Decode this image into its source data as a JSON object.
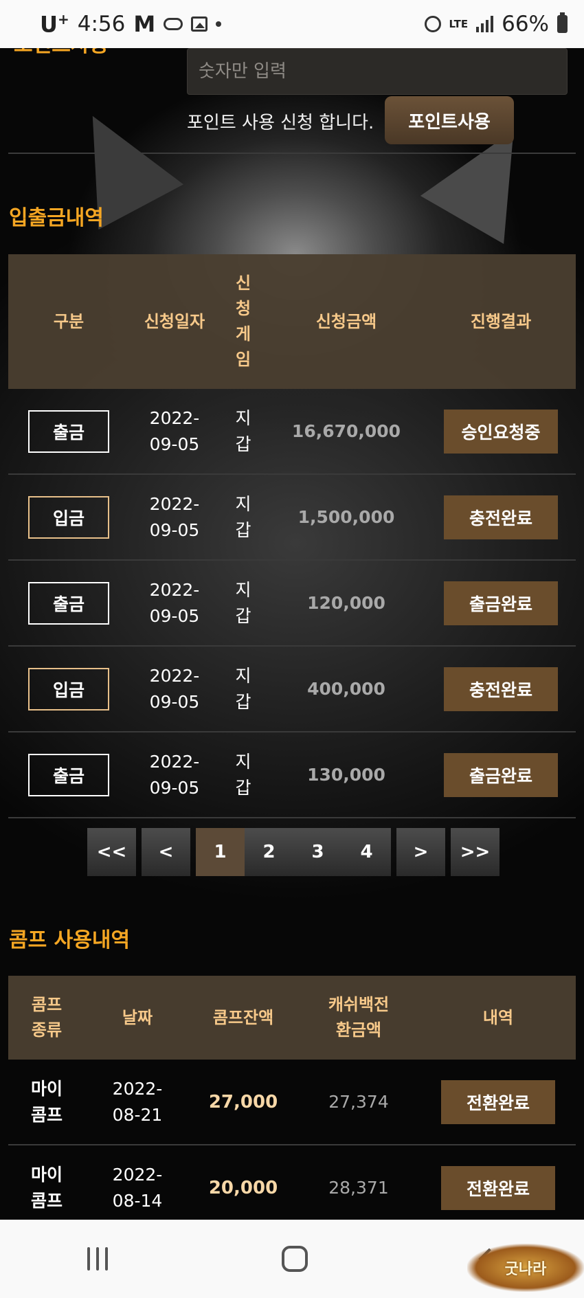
{
  "status_bar": {
    "carrier": "U",
    "carrier_sup": "+",
    "time": "4:56",
    "notif_m": "M",
    "lte": "LTE",
    "battery_percent": "66%"
  },
  "point_section": {
    "partial_heading": "포인트사용",
    "input_placeholder": "숫자만 입력",
    "request_label": "포인트 사용 신청 합니다.",
    "submit_label": "포인트사용"
  },
  "transactions": {
    "title": "입출금내역",
    "headers": [
      "구분",
      "신청일자",
      "신청게임",
      "신청금액",
      "진행결과"
    ],
    "rows": [
      {
        "type": "출금",
        "kind": "out",
        "date": "2022-09-05",
        "game": "지갑",
        "amount": "16,670,000",
        "result": "승인요청중"
      },
      {
        "type": "입금",
        "kind": "in",
        "date": "2022-09-05",
        "game": "지갑",
        "amount": "1,500,000",
        "result": "충전완료"
      },
      {
        "type": "출금",
        "kind": "out",
        "date": "2022-09-05",
        "game": "지갑",
        "amount": "120,000",
        "result": "출금완료"
      },
      {
        "type": "입금",
        "kind": "in",
        "date": "2022-09-05",
        "game": "지갑",
        "amount": "400,000",
        "result": "충전완료"
      },
      {
        "type": "출금",
        "kind": "out",
        "date": "2022-09-05",
        "game": "지갑",
        "amount": "130,000",
        "result": "출금완료"
      }
    ]
  },
  "pagination": {
    "first": "<<",
    "prev": "<",
    "pages": [
      "1",
      "2",
      "3",
      "4"
    ],
    "current": "1",
    "next": ">",
    "last": ">>"
  },
  "comp": {
    "title": "콤프 사용내역",
    "headers": [
      "콤프종류",
      "날짜",
      "콤프잔액",
      "캐쉬백전환금액",
      "내역"
    ],
    "rows": [
      {
        "type": "마이콤프",
        "date": "2022-08-21",
        "balance": "27,000",
        "cashback": "27,374",
        "result": "전환완료"
      },
      {
        "type": "마이콤프",
        "date": "2022-08-14",
        "balance": "20,000",
        "cashback": "28,371",
        "result": "전환완료"
      }
    ]
  },
  "logo": {
    "text": "굿나라"
  },
  "colors": {
    "accent": "#f5a623",
    "header_bg": "#4a3e30",
    "result_btn": "#6a4d2c"
  }
}
